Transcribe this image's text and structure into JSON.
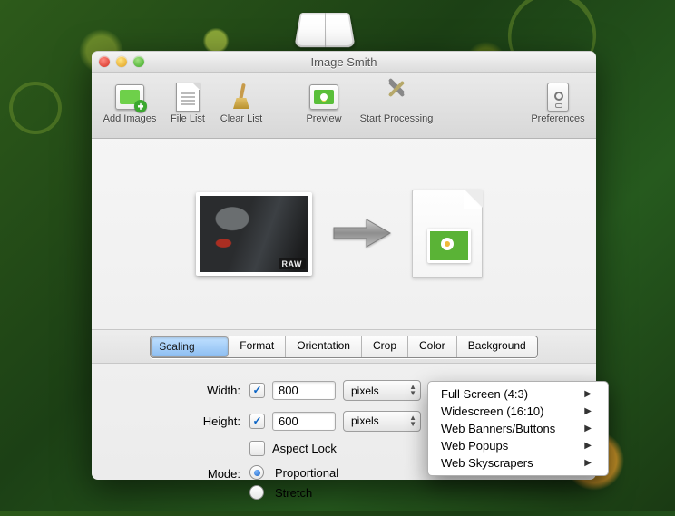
{
  "window": {
    "title": "Image Smith"
  },
  "toolbar": {
    "add_images": "Add Images",
    "file_list": "File List",
    "clear_list": "Clear List",
    "preview": "Preview",
    "start_processing": "Start Processing",
    "preferences": "Preferences"
  },
  "preview": {
    "raw_badge": "RAW"
  },
  "tabs": {
    "scaling": "Scaling",
    "format": "Format",
    "orientation": "Orientation",
    "crop": "Crop",
    "color": "Color",
    "background": "Background",
    "selected": "scaling"
  },
  "scaling": {
    "width_label": "Width:",
    "height_label": "Height:",
    "width_enabled": true,
    "height_enabled": true,
    "width_value": "800",
    "height_value": "600",
    "width_unit": "pixels",
    "height_unit": "pixels",
    "aspect_lock_label": "Aspect Lock",
    "aspect_lock": false,
    "mode_label": "Mode:",
    "mode_proportional": "Proportional",
    "mode_stretch": "Stretch",
    "mode_selected": "proportional"
  },
  "presets_menu": {
    "items": [
      "Full Screen (4:3)",
      "Widescreen (16:10)",
      "Web Banners/Buttons",
      "Web Popups",
      "Web Skyscrapers"
    ]
  }
}
